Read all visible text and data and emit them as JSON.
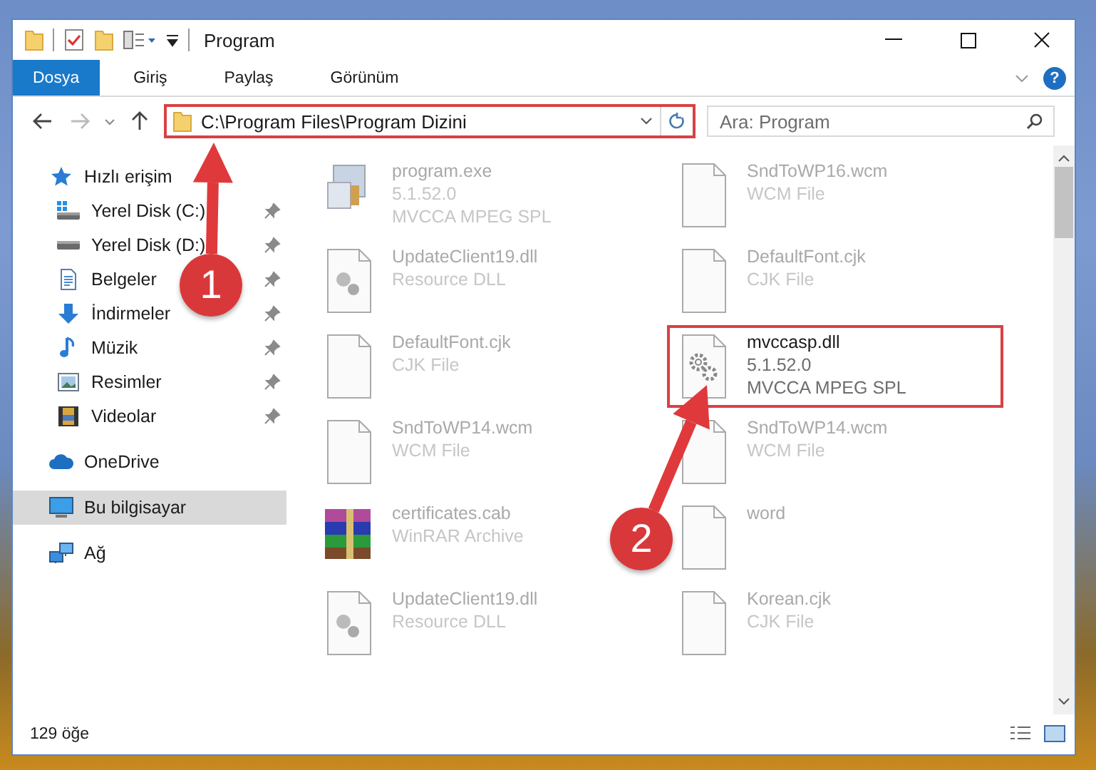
{
  "window": {
    "title": "Program"
  },
  "ribbon_tabs": [
    {
      "label": "Dosya",
      "selected": true
    },
    {
      "label": "Giriş",
      "selected": false
    },
    {
      "label": "Paylaş",
      "selected": false
    },
    {
      "label": "Görünüm",
      "selected": false
    }
  ],
  "help_button": "?",
  "address_bar": {
    "path": "C:\\Program Files\\Program Dizini",
    "highlighted": true
  },
  "search": {
    "placeholder": "Ara: Program"
  },
  "sidebar": {
    "items": [
      {
        "label": "Hızlı erişim",
        "kind": "star",
        "selected": false,
        "children": [
          {
            "label": "Yerel Disk (C:)",
            "kind": "drive-c",
            "pinned": true,
            "selected": false
          },
          {
            "label": "Yerel Disk (D:)",
            "kind": "drive",
            "pinned": true,
            "selected": false
          },
          {
            "label": "Belgeler",
            "kind": "documents",
            "pinned": true,
            "selected": false
          },
          {
            "label": "İndirmeler",
            "kind": "download",
            "pinned": true,
            "selected": false
          },
          {
            "label": "Müzik",
            "kind": "music",
            "pinned": true,
            "selected": false
          },
          {
            "label": "Resimler",
            "kind": "pictures",
            "pinned": true,
            "selected": false
          },
          {
            "label": "Videolar",
            "kind": "videos",
            "pinned": true,
            "selected": false
          }
        ]
      },
      {
        "label": "OneDrive",
        "kind": "cloud",
        "selected": false
      },
      {
        "label": "Bu bilgisayar",
        "kind": "computer",
        "selected": true
      },
      {
        "label": "Ağ",
        "kind": "network",
        "selected": false
      }
    ]
  },
  "files": [
    {
      "name": "program.exe",
      "details": [
        "5.1.52.0",
        "MVCCA MPEG SPL"
      ],
      "kind": "exe",
      "emphasized": false
    },
    {
      "name": "SndToWP16.wcm",
      "details": [
        "WCM File"
      ],
      "kind": "page",
      "emphasized": false
    },
    {
      "name": "UpdateClient19.dll",
      "details": [
        "Resource DLL"
      ],
      "kind": "dll",
      "emphasized": false
    },
    {
      "name": "DefaultFont.cjk",
      "details": [
        "CJK File"
      ],
      "kind": "page",
      "emphasized": false
    },
    {
      "name": "DefaultFont.cjk",
      "details": [
        "CJK File"
      ],
      "kind": "page",
      "emphasized": false
    },
    {
      "name": "mvccasp.dll",
      "details": [
        "5.1.52.0",
        "MVCCA MPEG SPL"
      ],
      "kind": "gear",
      "emphasized": true
    },
    {
      "name": "SndToWP14.wcm",
      "details": [
        "WCM File"
      ],
      "kind": "page",
      "emphasized": false
    },
    {
      "name": "SndToWP14.wcm",
      "details": [
        "WCM File"
      ],
      "kind": "page",
      "emphasized": false
    },
    {
      "name": "certificates.cab",
      "details": [
        "WinRAR Archive"
      ],
      "kind": "archive",
      "emphasized": false
    },
    {
      "name": "word",
      "kind": "page",
      "emphasized": false
    },
    {
      "name": "UpdateClient19.dll",
      "details": [
        "Resource DLL"
      ],
      "kind": "dll",
      "emphasized": false
    },
    {
      "name": "Korean.cjk",
      "details": [
        "CJK File"
      ],
      "kind": "page",
      "emphasized": false
    }
  ],
  "status_bar": {
    "item_count": "129 öğe"
  },
  "annotations": [
    {
      "number": "1"
    },
    {
      "number": "2"
    }
  ]
}
